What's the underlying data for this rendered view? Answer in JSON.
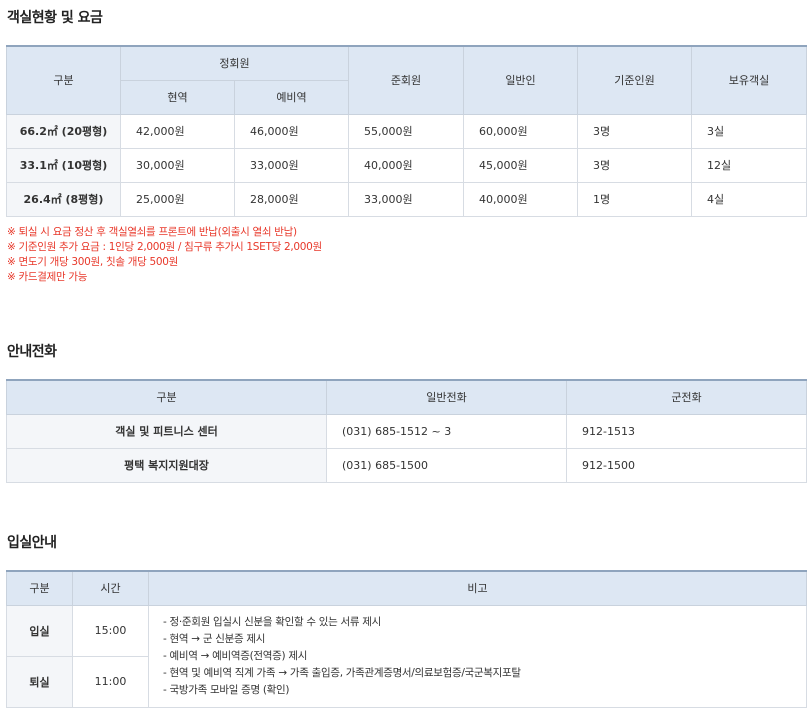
{
  "rooms": {
    "title": "객실현황 및 요금",
    "headers": {
      "category": "구분",
      "regular_member": "정회원",
      "active_duty": "현역",
      "reserve": "예비역",
      "associate": "준회원",
      "general": "일반인",
      "base_capacity": "기준인원",
      "rooms_owned": "보유객실"
    },
    "rows": [
      {
        "type": "66.2㎡ (20평형)",
        "active": "42,000원",
        "reserve": "46,000원",
        "associate": "55,000원",
        "general": "60,000원",
        "capacity": "3명",
        "count": "3실"
      },
      {
        "type": "33.1㎡ (10평형)",
        "active": "30,000원",
        "reserve": "33,000원",
        "associate": "40,000원",
        "general": "45,000원",
        "capacity": "3명",
        "count": "12실"
      },
      {
        "type": "26.4㎡ (8평형)",
        "active": "25,000원",
        "reserve": "28,000원",
        "associate": "33,000원",
        "general": "40,000원",
        "capacity": "1명",
        "count": "4실"
      }
    ],
    "notes": [
      "※ 퇴실 시 요금 정산 후 객실열쇠를 프론트에 반납(외출시 열쇠 반납)",
      "※ 기준인원 추가 요금 : 1인당 2,000원 / 침구류 추가시 1SET당 2,000원",
      "※ 면도기 개당 300원, 칫솔 개당 500원",
      "※ 카드결제만 가능"
    ],
    "note_color": "#e8382a"
  },
  "phone": {
    "title": "안내전화",
    "headers": {
      "category": "구분",
      "general_phone": "일반전화",
      "military_phone": "군전화"
    },
    "rows": [
      {
        "name": "객실 및 피트니스 센터",
        "general": "(031) 685-1512 ~ 3",
        "military": "912-1513"
      },
      {
        "name": "평택 복지지원대장",
        "general": "(031) 685-1500",
        "military": "912-1500"
      }
    ]
  },
  "checkin": {
    "title": "입실안내",
    "headers": {
      "category": "구분",
      "time": "시간",
      "remarks": "비고"
    },
    "rows": [
      {
        "label": "입실",
        "time": "15:00"
      },
      {
        "label": "퇴실",
        "time": "11:00"
      }
    ],
    "remarks": [
      "정·준회원 입실시 신분을 확인할 수 있는 서류 제시",
      "현역 → 군 신분증 제시",
      "예비역 → 예비역증(전역증) 제시",
      "현역 및 예비역 직계 가족 → 가족 출입증, 가족관계증명서/의료보험증/국군복지포탈",
      "국방가족 모바일 증명 (확인)"
    ]
  },
  "colors": {
    "header_bg": "#dde7f3",
    "header_top_border": "#8fa4bd",
    "row_head_bg": "#f4f6f9",
    "border": "#d7dce3"
  }
}
